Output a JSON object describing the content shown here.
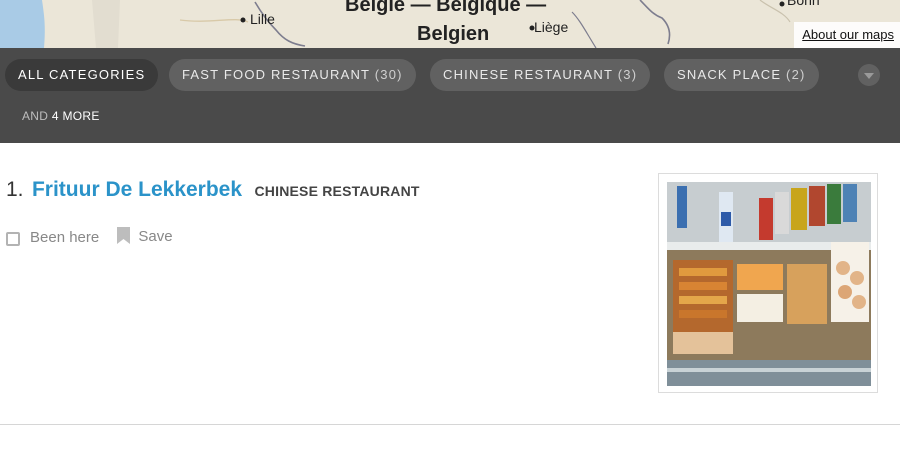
{
  "map": {
    "cities": {
      "lille": "Lille",
      "liege": "Liège",
      "bonn": "Bonn"
    },
    "country_line1": "België — Belgique —",
    "country_line2": "Belgien",
    "credit": "About our maps"
  },
  "categories": {
    "items": [
      {
        "label": "ALL CATEGORIES",
        "count": ""
      },
      {
        "label": "FAST FOOD RESTAURANT",
        "count": "(30)"
      },
      {
        "label": "CHINESE RESTAURANT",
        "count": "(3)"
      },
      {
        "label": "SNACK PLACE",
        "count": "(2)"
      }
    ],
    "and_more_prefix": "AND",
    "and_more_highlight": "4 MORE"
  },
  "result": {
    "rank": "1.",
    "name": "Frituur De Lekkerbek",
    "category": "CHINESE RESTAURANT",
    "been_here_label": "Been here",
    "save_label": "Save"
  },
  "colors": {
    "accent_link": "#2b93c9",
    "category_bar": "#4a4a4a",
    "pill": "#616161",
    "map_land": "#ebe6d8",
    "map_sea": "#a9cbe6"
  }
}
